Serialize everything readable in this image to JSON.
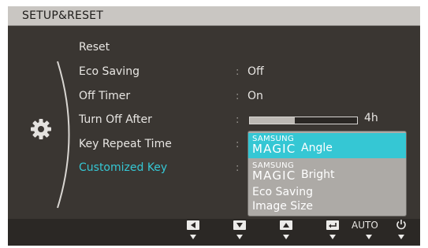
{
  "osd": {
    "title": "SETUP&RESET",
    "menu": [
      {
        "label": "Reset",
        "value": ""
      },
      {
        "label": "Eco Saving",
        "value": "Off"
      },
      {
        "label": "Off Timer",
        "value": "On"
      },
      {
        "label": "Turn Off After",
        "value": ""
      },
      {
        "label": "Key Repeat Time",
        "value": ""
      },
      {
        "label": "Customized Key",
        "value": ""
      }
    ],
    "colon": ":",
    "turn_off_after": {
      "level": 0.42,
      "value_text": "4h"
    },
    "dropdown": {
      "items": [
        {
          "brand_top": "SAMSUNG",
          "brand_main": "MAGIC",
          "label": "Angle",
          "selected": true
        },
        {
          "brand_top": "SAMSUNG",
          "brand_main": "MAGIC",
          "label": "Bright",
          "selected": false
        },
        {
          "label": "Eco Saving",
          "selected": false
        },
        {
          "label": "Image Size",
          "selected": false
        }
      ]
    },
    "buttons": {
      "auto_label": "AUTO",
      "icons": [
        "left-icon",
        "down-icon",
        "up-icon",
        "enter-icon",
        "auto",
        "power-icon"
      ]
    },
    "colors": {
      "accent": "#35c7d4",
      "background": "#3a3632",
      "title_bar": "#c9c6c2"
    }
  }
}
